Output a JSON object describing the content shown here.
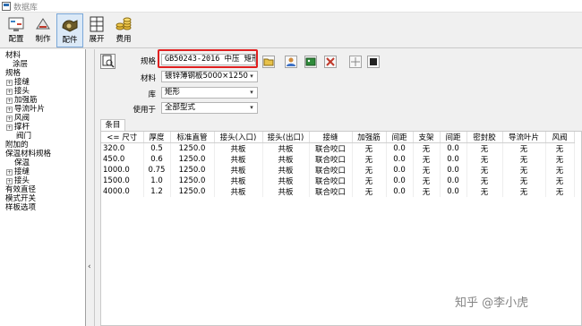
{
  "window": {
    "title": "数据库"
  },
  "toolbar": {
    "buttons": [
      {
        "label": "配置"
      },
      {
        "label": "制作"
      },
      {
        "label": "配件"
      },
      {
        "label": "展开"
      },
      {
        "label": "费用"
      }
    ]
  },
  "tree": {
    "items": [
      {
        "label": "材料",
        "expander": ""
      },
      {
        "label": "涂层",
        "expander": ""
      },
      {
        "label": "规格",
        "expander": ""
      },
      {
        "label": "接缝",
        "expander": "+"
      },
      {
        "label": "接头",
        "expander": "+"
      },
      {
        "label": "加强筋",
        "expander": "+"
      },
      {
        "label": "导流叶片",
        "expander": "+"
      },
      {
        "label": "风阀",
        "expander": "+"
      },
      {
        "label": "撑杆",
        "expander": "+"
      },
      {
        "label": "阀门",
        "expander": ""
      },
      {
        "label": "附加的",
        "expander": ""
      },
      {
        "label": "保温材料规格",
        "expander": ""
      },
      {
        "label": "保温",
        "expander": ""
      },
      {
        "label": "接缝",
        "expander": "+"
      },
      {
        "label": "接头",
        "expander": "+"
      },
      {
        "label": "有效直径",
        "expander": ""
      },
      {
        "label": "模式开关",
        "expander": ""
      },
      {
        "label": "样板选项",
        "expander": ""
      }
    ]
  },
  "filters": {
    "spec_label": "规格",
    "spec_value": "GB50243-2016 中压 矩形",
    "material_label": "材料",
    "material_value": "镀锌薄钢板5000×1250",
    "library_label": "库",
    "library_value": "矩形",
    "usage_label": "使用于",
    "usage_value": "全部型式"
  },
  "tab": {
    "label": "条目"
  },
  "table": {
    "headers": [
      "<= 尺寸",
      "厚度",
      "标准直管",
      "接头(入口)",
      "接头(出口)",
      "接缝",
      "加强筋",
      "间距",
      "支架",
      "间距",
      "密封胶",
      "导流叶片",
      "风阀"
    ],
    "rows": [
      [
        "320.0",
        "0.5",
        "1250.0",
        "共板",
        "共板",
        "联合咬口",
        "无",
        "0.0",
        "无",
        "0.0",
        "无",
        "无",
        "无"
      ],
      [
        "450.0",
        "0.6",
        "1250.0",
        "共板",
        "共板",
        "联合咬口",
        "无",
        "0.0",
        "无",
        "0.0",
        "无",
        "无",
        "无"
      ],
      [
        "1000.0",
        "0.75",
        "1250.0",
        "共板",
        "共板",
        "联合咬口",
        "无",
        "0.0",
        "无",
        "0.0",
        "无",
        "无",
        "无"
      ],
      [
        "1500.0",
        "1.0",
        "1250.0",
        "共板",
        "共板",
        "联合咬口",
        "无",
        "0.0",
        "无",
        "0.0",
        "无",
        "无",
        "无"
      ],
      [
        "4000.0",
        "1.2",
        "1250.0",
        "共板",
        "共板",
        "联合咬口",
        "无",
        "0.0",
        "无",
        "0.0",
        "无",
        "无",
        "无"
      ]
    ]
  },
  "watermark": {
    "text": "知乎 @李小虎"
  }
}
